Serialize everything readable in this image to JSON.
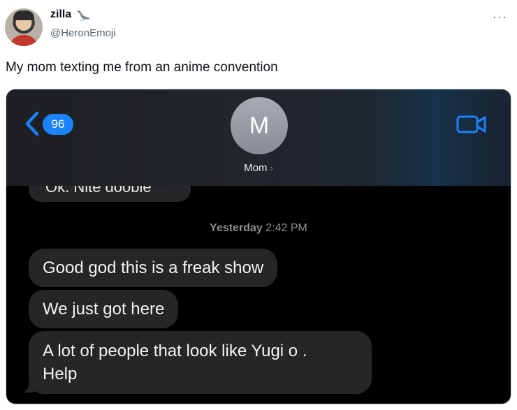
{
  "tweet": {
    "display_name": "zilla",
    "handle": "@HeronEmoji",
    "more_label": "···",
    "text": "My mom texting me from an anime convention"
  },
  "messages_ui": {
    "nav": {
      "badge_count": "96",
      "contact_initial": "M",
      "contact_name": "Mom",
      "contact_chevron": "›"
    },
    "partial_message": "Ok. Nite doobie",
    "timestamp": {
      "day": "Yesterday",
      "time": "2:42 PM"
    },
    "messages": [
      "Good god this is a freak show",
      "We just got here",
      "A lot of people that look like Yugi o .\nHelp"
    ]
  },
  "colors": {
    "ios_blue": "#1a82fb",
    "bubble_gray": "#262628",
    "background": "#000000"
  },
  "icons": [
    "heron-icon",
    "more-icon",
    "back-chevron-icon",
    "video-call-icon"
  ]
}
